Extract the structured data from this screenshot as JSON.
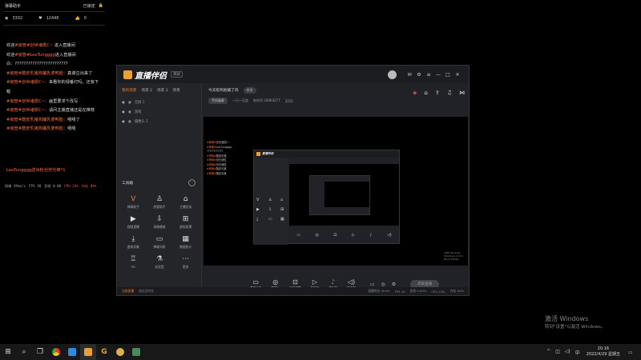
{
  "danmu": {
    "title": "弹幕助手",
    "toggle_label": "已锁定",
    "stat1": "3302",
    "stat2": "12446",
    "stat3": "0",
    "messages": [
      {
        "prefix": "",
        "name": "",
        "text": "欢迎",
        "highlight": "#房管#创世诸侯C~",
        "suffix": " 进入直播间"
      },
      {
        "prefix": "",
        "name": "",
        "text": "欢迎",
        "highlight": "#房管#LeoTungggg",
        "suffix": "进入直播间"
      },
      {
        "prefix": "",
        "name": "",
        "text": "白：",
        "highlight": "",
        "suffix": "????????????????????????"
      },
      {
        "prefix": "",
        "name": "",
        "text": "",
        "highlight": "#房管#酷皮乳猪狗蹦乳婆鸭脸：",
        "suffix": "真谢泣出来了"
      },
      {
        "prefix": "",
        "name": "",
        "text": "",
        "highlight": "#房管#创世诸侯C~：",
        "suffix": "来看你的绿番灯吗，还有下载"
      },
      {
        "prefix": "",
        "name": "",
        "text": "",
        "highlight": "#房管#创世诸侯C~：",
        "suffix": "画里要求个改写"
      },
      {
        "prefix": "",
        "name": "",
        "text": "",
        "highlight": "#房管#创世诸侯C~：",
        "suffix": "请问主播直播还是在推荐"
      },
      {
        "prefix": "",
        "name": "",
        "text": "",
        "highlight": "#房管#酷皮乳猪狗蹦乳婆鸭脸：",
        "suffix": "嘻嘻了"
      },
      {
        "prefix": "",
        "name": "",
        "text": "",
        "highlight": "#房管#酷皮乳猪狗蹦乳婆鸭脸：",
        "suffix": "嘻嘻"
      }
    ],
    "welcome": "LeoTungggg送出粉丝荧光棒*1",
    "perf": [
      "网络 39ms/s",
      "FPS 30",
      "丢帧 0.00",
      "CPU 24%",
      "内存 84%"
    ]
  },
  "app": {
    "logo": "直播伴侣",
    "version": "测试",
    "tabs": [
      "我的场景",
      "场景 2",
      "场景 3",
      "场景"
    ],
    "scenes": [
      "全屏 1",
      "游戏",
      "摄像头 1"
    ],
    "room_title": "今天玩鸡他输了吗",
    "room_tag": "修改",
    "meta_tag": "手机录屏",
    "meta1": "一日一见会",
    "meta2": "房间号 50064277",
    "meta3": "3352",
    "tools_title": "工具箱",
    "tools": [
      {
        "icon": "V",
        "label": "弹幕助手",
        "hl": true
      },
      {
        "icon": "♙",
        "label": "房管助手",
        "hl": false
      },
      {
        "icon": "⌂",
        "label": "主播任务",
        "hl": false
      },
      {
        "icon": "▶",
        "label": "视频直播",
        "hl": false
      },
      {
        "icon": "⇩",
        "label": "录像播放",
        "hl": false
      },
      {
        "icon": "⊞",
        "label": "虚拟背景",
        "hl": false
      },
      {
        "icon": "⤓",
        "label": "虚拟形象",
        "hl": false
      },
      {
        "icon": "▭",
        "label": "弹幕列表",
        "hl": false
      },
      {
        "icon": "▦",
        "label": "数据统计",
        "hl": false
      },
      {
        "icon": "♖",
        "label": "PK",
        "hl": false
      },
      {
        "icon": "⚗",
        "label": "实验室",
        "hl": false
      },
      {
        "icon": "⋯",
        "label": "更多",
        "hl": false
      }
    ],
    "controls": [
      {
        "icon": "▭",
        "label": "直播画面"
      },
      {
        "icon": "◎",
        "label": "摄像头"
      },
      {
        "icon": "⊡",
        "label": "手机投屏"
      },
      {
        "icon": "▷",
        "label": "多媒体"
      },
      {
        "icon": "♪",
        "label": "麦克风"
      },
      {
        "icon": "◁)",
        "label": "扬声器"
      }
    ],
    "go_live": "结束直播",
    "status": [
      "当前直播",
      "经过总时长",
      "直播时长 00:00",
      "FPS 30",
      "丢帧 0.00%",
      "CPU 24%",
      "内存 84%"
    ],
    "preview_watermark": [
      "OBS Windows",
      "Windows 11 Pro",
      "Build 19044"
    ]
  },
  "activation": {
    "line1": "激活 Windows",
    "line2": "转到\"设置\"以激活 Windows。"
  },
  "taskbar": {
    "time": "20:16",
    "date": "2022/4/29 星期五"
  }
}
